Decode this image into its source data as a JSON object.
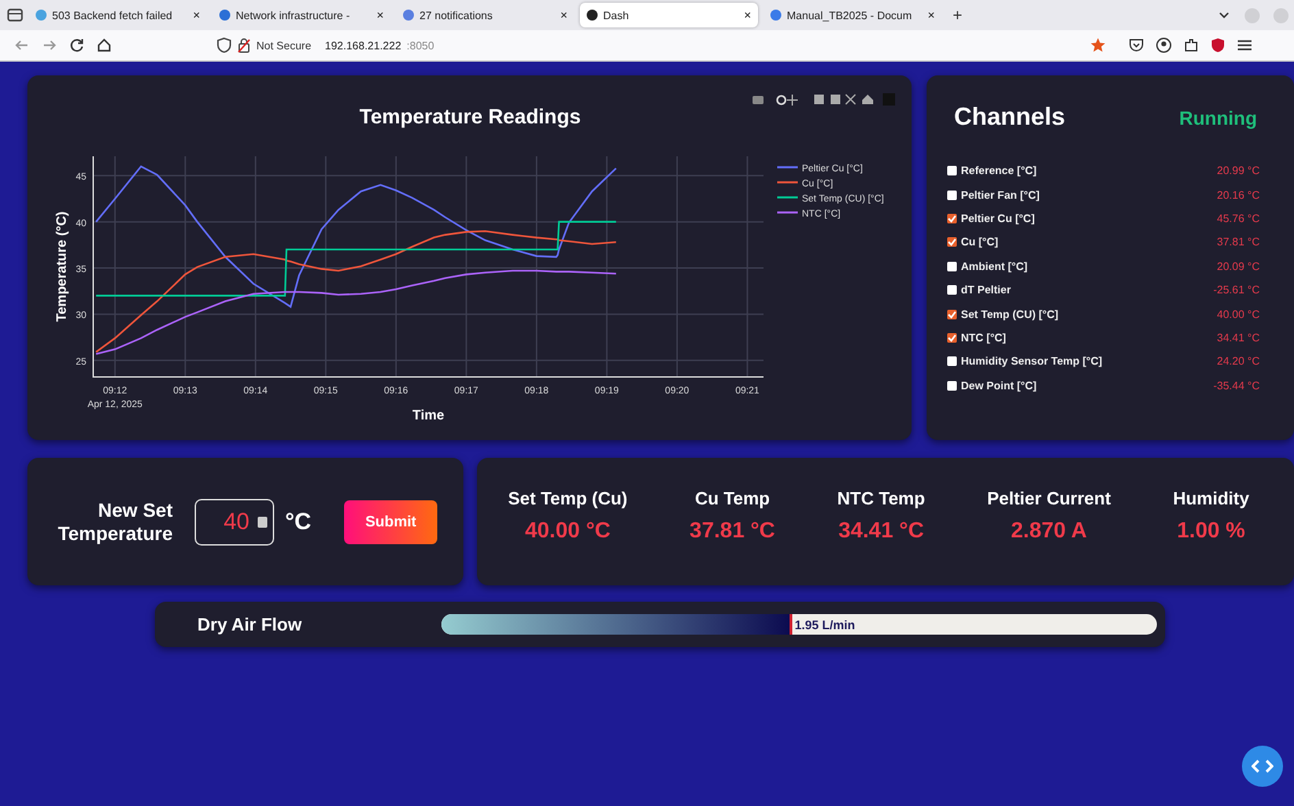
{
  "browser": {
    "tabs": [
      {
        "title": "503 Backend fetch failed",
        "selected": false,
        "close": "×"
      },
      {
        "title": "Network infrastructure - ",
        "selected": false,
        "close": "×"
      },
      {
        "title": "27 notifications",
        "selected": false,
        "close": "×"
      },
      {
        "title": "Dash",
        "selected": true,
        "close": "×"
      },
      {
        "title": "Manual_TB2025 - Docum",
        "selected": false,
        "close": "×"
      }
    ],
    "new_tab": "+",
    "security": "Not Secure",
    "url_host": "192.168.21.222",
    "url_port": ":8050"
  },
  "chart_card": {
    "date_label": "Apr 12, 2025",
    "chart_data": {
      "type": "line",
      "title": "Temperature Readings",
      "xlabel": "Time",
      "ylabel": "Temperature (°C)",
      "grid": true,
      "legend": true,
      "x": [
        551.73,
        552.0,
        552.37,
        552.6,
        553.0,
        553.17,
        553.57,
        553.97,
        554.42,
        554.44,
        554.5,
        554.62,
        554.94,
        555.18,
        555.5,
        555.78,
        556.0,
        556.23,
        556.54,
        556.7,
        557.0,
        557.27,
        557.66,
        558.0,
        558.28,
        558.3,
        558.32,
        558.46,
        558.79,
        559.13
      ],
      "series": [
        {
          "name": "Peltier Cu [°C]",
          "color": "#636efa",
          "values": [
            40,
            42.5,
            46.0,
            45.1,
            41.8,
            40,
            36.2,
            33.3,
            31.2,
            31.1,
            30.8,
            34.2,
            39.2,
            41.3,
            43.3,
            44.0,
            43.4,
            42.6,
            41.3,
            40.5,
            39.1,
            38.0,
            37.0,
            36.3,
            36.2,
            36.4,
            37.0,
            39.9,
            43.3,
            45.8
          ]
        },
        {
          "name": "Cu [°C]",
          "color": "#ef553b",
          "values": [
            25.9,
            27.4,
            29.9,
            31.4,
            34.3,
            35.1,
            36.2,
            36.5,
            35.9,
            35.8,
            35.7,
            35.4,
            34.9,
            34.7,
            35.2,
            35.9,
            36.5,
            37.3,
            38.3,
            38.6,
            38.9,
            39.0,
            38.6,
            38.3,
            38.1,
            38.1,
            38.0,
            37.9,
            37.6,
            37.8
          ]
        },
        {
          "name": "Set Temp (CU) [°C]",
          "color": "#00cc96",
          "values": [
            32,
            32,
            32,
            32,
            32,
            32,
            32,
            32,
            32,
            37,
            37,
            37,
            37,
            37,
            37,
            37,
            37,
            37,
            37,
            37,
            37,
            37,
            37,
            37,
            37,
            37,
            40,
            40,
            40,
            40
          ]
        },
        {
          "name": "NTC [°C]",
          "color": "#ab63fa",
          "values": [
            25.7,
            26.2,
            27.4,
            28.3,
            29.7,
            30.2,
            31.4,
            32.2,
            32.4,
            32.4,
            32.4,
            32.4,
            32.3,
            32.1,
            32.2,
            32.4,
            32.7,
            33.1,
            33.6,
            33.9,
            34.3,
            34.5,
            34.7,
            34.7,
            34.6,
            34.6,
            34.6,
            34.6,
            34.5,
            34.4
          ]
        }
      ],
      "xlim": [
        551.69,
        561.23
      ],
      "ylim": [
        23.2,
        47.1
      ],
      "xticks": [
        {
          "value": 552,
          "label": "09:12"
        },
        {
          "value": 553,
          "label": "09:13"
        },
        {
          "value": 554,
          "label": "09:14"
        },
        {
          "value": 555,
          "label": "09:15"
        },
        {
          "value": 556,
          "label": "09:16"
        },
        {
          "value": 557,
          "label": "09:17"
        },
        {
          "value": 558,
          "label": "09:18"
        },
        {
          "value": 559,
          "label": "09:19"
        },
        {
          "value": 560,
          "label": "09:20"
        },
        {
          "value": 561,
          "label": "09:21"
        }
      ],
      "yticks": [
        25,
        30,
        35,
        40,
        45
      ]
    }
  },
  "channels": {
    "title": "Channels",
    "status": "Running",
    "items": [
      {
        "name": "Reference [°C]",
        "checked": false,
        "value": "20.99 °C"
      },
      {
        "name": "Peltier Fan [°C]",
        "checked": false,
        "value": "20.16 °C"
      },
      {
        "name": "Peltier Cu [°C]",
        "checked": true,
        "value": "45.76 °C"
      },
      {
        "name": "Cu [°C]",
        "checked": true,
        "value": "37.81 °C"
      },
      {
        "name": "Ambient [°C]",
        "checked": false,
        "value": "20.09 °C"
      },
      {
        "name": "dT Peltier",
        "checked": false,
        "value": "-25.61 °C"
      },
      {
        "name": "Set Temp (CU) [°C]",
        "checked": true,
        "value": "40.00 °C"
      },
      {
        "name": "NTC [°C]",
        "checked": true,
        "value": "34.41 °C"
      },
      {
        "name": "Humidity Sensor Temp [°C]",
        "checked": false,
        "value": "24.20 °C"
      },
      {
        "name": "Dew Point [°C]",
        "checked": false,
        "value": "-35.44 °C"
      }
    ]
  },
  "set_temperature": {
    "label": "New Set Temperature",
    "value": "40",
    "unit": "°C",
    "button": "Submit"
  },
  "metrics": [
    {
      "label": "Set Temp (Cu)",
      "value": "40.00 °C"
    },
    {
      "label": "Cu Temp",
      "value": "37.81 °C"
    },
    {
      "label": "NTC Temp",
      "value": "34.41 °C"
    },
    {
      "label": "Peltier Current",
      "value": "2.870 A"
    },
    {
      "label": "Humidity",
      "value": "1.00 %"
    }
  ],
  "air_flow": {
    "label": "Dry Air Flow",
    "level": 0.49,
    "reading": "1.95 L/min"
  }
}
